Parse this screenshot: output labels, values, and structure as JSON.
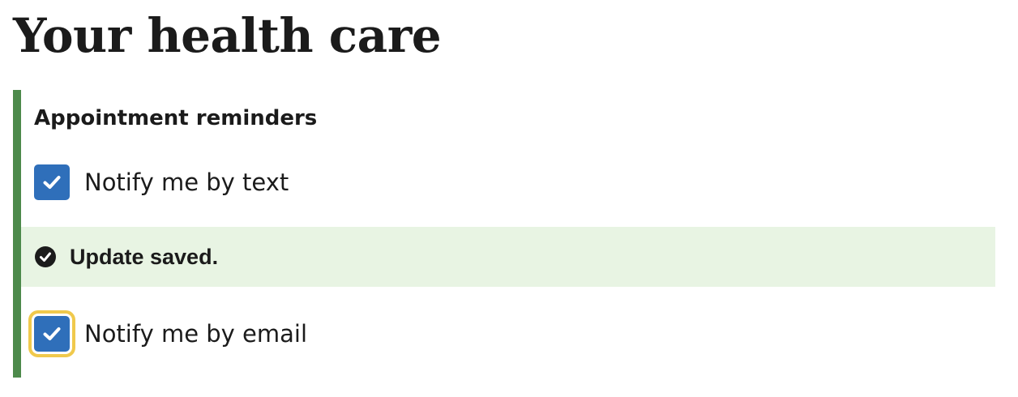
{
  "page": {
    "title": "Your health care"
  },
  "reminders": {
    "legend": "Appointment reminders",
    "options": [
      {
        "label": "Notify me by text",
        "checked": true,
        "focused": false
      },
      {
        "label": "Notify me by email",
        "checked": true,
        "focused": true
      }
    ],
    "alert": {
      "status": "success",
      "icon": "check-circle-icon",
      "message": "Update saved."
    }
  },
  "colors": {
    "accent_border": "#4d8a4b",
    "checkbox_fill": "#2f6fba",
    "focus_ring": "#f0c94c",
    "alert_background": "#e8f4e3",
    "text": "#1b1b1b"
  }
}
